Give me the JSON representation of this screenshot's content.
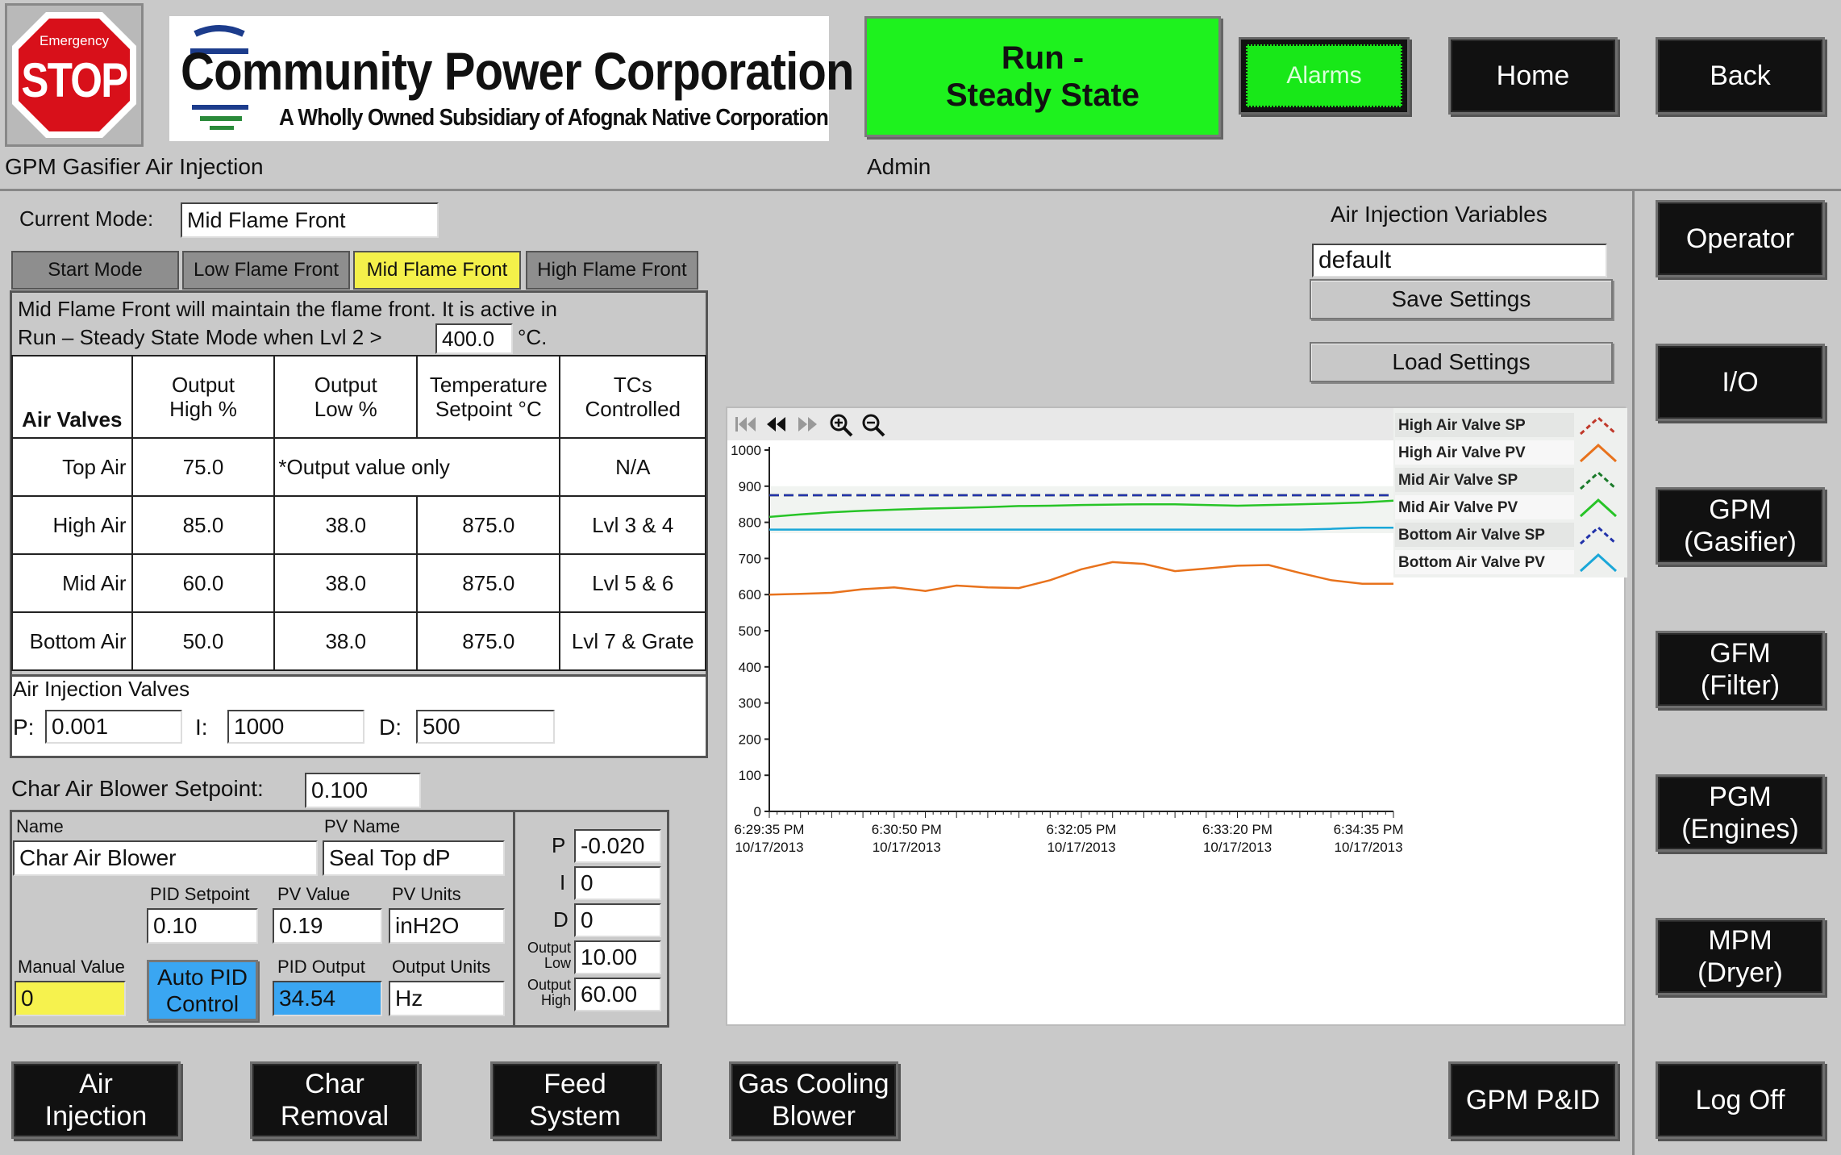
{
  "header": {
    "estop_small": "Emergency",
    "estop_big": "STOP",
    "company_name": "Community Power Corporation",
    "company_sub": "A Wholly Owned Subsidiary of Afognak Native Corporation",
    "status_line1": "Run -",
    "status_line2": "Steady State",
    "alarms": "Alarms",
    "home": "Home",
    "back": "Back",
    "screen_title": "GPM Gasifier Air Injection",
    "user": "Admin"
  },
  "mode": {
    "current_label": "Current Mode:",
    "current_value": "Mid Flame Front",
    "tabs": [
      "Start Mode",
      "Low Flame Front",
      "Mid Flame Front",
      "High Flame Front"
    ],
    "active_tab": 2,
    "desc1": "Mid Flame Front will maintain the flame front. It is active in",
    "desc2": "Run – Steady State Mode when Lvl 2 >",
    "threshold": "400.0",
    "unit": "°C."
  },
  "valves": {
    "col_headers": [
      "Air Valves",
      "Output High %",
      "Output Low %",
      "Temperature Setpoint °C",
      "TCs Controlled"
    ],
    "top_row": {
      "name": "Top Air",
      "high": "75.0",
      "note": "*Output value only",
      "tcs": "N/A"
    },
    "rows": [
      {
        "name": "High Air",
        "high": "85.0",
        "low": "38.0",
        "sp": "875.0",
        "tcs": "Lvl 3 & 4"
      },
      {
        "name": "Mid Air",
        "high": "60.0",
        "low": "38.0",
        "sp": "875.0",
        "tcs": "Lvl 5 & 6"
      },
      {
        "name": "Bottom Air",
        "high": "50.0",
        "low": "38.0",
        "sp": "875.0",
        "tcs": "Lvl 7 & Grate"
      }
    ]
  },
  "pid": {
    "title": "Air Injection Valves",
    "p_label": "P:",
    "p": "0.001",
    "i_label": "I:",
    "i": "1000",
    "d_label": "D:",
    "d": "500"
  },
  "char": {
    "setpoint_label": "Char Air Blower Setpoint:",
    "setpoint": "0.100",
    "name_label": "Name",
    "name": "Char Air Blower",
    "pv_name_label": "PV Name",
    "pv_name": "Seal Top dP",
    "pid_sp_label": "PID Setpoint",
    "pid_sp": "0.10",
    "pv_value_label": "PV Value",
    "pv_value": "0.19",
    "pv_units_label": "PV Units",
    "pv_units": "inH2O",
    "manual_label": "Manual Value",
    "manual": "0",
    "auto_pid": "Auto PID Control",
    "pid_output_label": "PID Output",
    "pid_output": "34.54",
    "output_units_label": "Output Units",
    "output_units": "Hz",
    "p_label": "P",
    "p": "-0.020",
    "i_label": "I",
    "i": "0",
    "d_label": "D",
    "d": "0",
    "out_low_label": "Output Low",
    "out_low": "10.00",
    "out_high_label": "Output High",
    "out_high": "60.00"
  },
  "variables": {
    "title": "Air Injection Variables",
    "name": "default",
    "save": "Save Settings",
    "load": "Load Settings"
  },
  "chart_data": {
    "type": "line",
    "ylim": [
      0,
      1000
    ],
    "yticks": [
      0,
      100,
      200,
      300,
      400,
      500,
      600,
      700,
      800,
      900,
      1000
    ],
    "xticks": [
      {
        "t": "6:29:35 PM",
        "d": "10/17/2013"
      },
      {
        "t": "6:30:50 PM",
        "d": "10/17/2013"
      },
      {
        "t": "6:32:05 PM",
        "d": "10/17/2013"
      },
      {
        "t": "6:33:20 PM",
        "d": "10/17/2013"
      },
      {
        "t": "6:34:35 PM",
        "d": "10/17/2013"
      }
    ],
    "x": [
      0,
      0.05,
      0.1,
      0.15,
      0.2,
      0.25,
      0.3,
      0.35,
      0.4,
      0.45,
      0.5,
      0.55,
      0.6,
      0.65,
      0.7,
      0.75,
      0.8,
      0.85,
      0.9,
      0.95,
      1.0
    ],
    "series": [
      {
        "name": "High Air Valve SP",
        "color": "#c0392b",
        "dashed": true,
        "values": [
          875,
          875,
          875,
          875,
          875,
          875,
          875,
          875,
          875,
          875,
          875,
          875,
          875,
          875,
          875,
          875,
          875,
          875,
          875,
          875,
          875
        ]
      },
      {
        "name": "High Air Valve PV",
        "color": "#e8721c",
        "dashed": false,
        "values": [
          600,
          602,
          605,
          615,
          620,
          610,
          625,
          620,
          618,
          640,
          670,
          690,
          685,
          665,
          672,
          680,
          682,
          660,
          640,
          630,
          630
        ]
      },
      {
        "name": "Mid Air Valve SP",
        "color": "#1a7a2a",
        "dashed": true,
        "values": [
          875,
          875,
          875,
          875,
          875,
          875,
          875,
          875,
          875,
          875,
          875,
          875,
          875,
          875,
          875,
          875,
          875,
          875,
          875,
          875,
          875
        ]
      },
      {
        "name": "Mid Air Valve PV",
        "color": "#27c427",
        "dashed": false,
        "values": [
          815,
          822,
          828,
          832,
          835,
          838,
          840,
          842,
          845,
          846,
          848,
          849,
          850,
          850,
          848,
          846,
          848,
          850,
          852,
          855,
          860
        ]
      },
      {
        "name": "Bottom Air Valve SP",
        "color": "#2233aa",
        "dashed": true,
        "values": [
          875,
          875,
          875,
          875,
          875,
          875,
          875,
          875,
          875,
          875,
          875,
          875,
          875,
          875,
          875,
          875,
          875,
          875,
          875,
          875,
          875
        ]
      },
      {
        "name": "Bottom Air Valve PV",
        "color": "#1aa7d8",
        "dashed": false,
        "values": [
          780,
          780,
          780,
          780,
          780,
          780,
          780,
          780,
          780,
          780,
          780,
          780,
          780,
          780,
          780,
          780,
          780,
          780,
          782,
          785,
          785
        ]
      }
    ]
  },
  "nav_right": [
    {
      "l1": "Operator",
      "l2": ""
    },
    {
      "l1": "I/O",
      "l2": ""
    },
    {
      "l1": "GPM",
      "l2": "(Gasifier)"
    },
    {
      "l1": "GFM",
      "l2": "(Filter)"
    },
    {
      "l1": "PGM",
      "l2": "(Engines)"
    },
    {
      "l1": "MPM",
      "l2": "(Dryer)"
    }
  ],
  "nav_bottom": {
    "air_injection": [
      "Air",
      "Injection"
    ],
    "char_removal": [
      "Char",
      "Removal"
    ],
    "feed_system": [
      "Feed",
      "System"
    ],
    "gas_cooling": [
      "Gas Cooling",
      "Blower"
    ],
    "gpm_pid": "GPM P&ID",
    "log_off": "Log Off"
  },
  "colors": {
    "status_green": "#1ef21e",
    "alarm_green": "#18e818",
    "active_tab": "#f4f04a",
    "manual_yellow": "#f6f24e",
    "auto_blue": "#3aa6f2"
  }
}
